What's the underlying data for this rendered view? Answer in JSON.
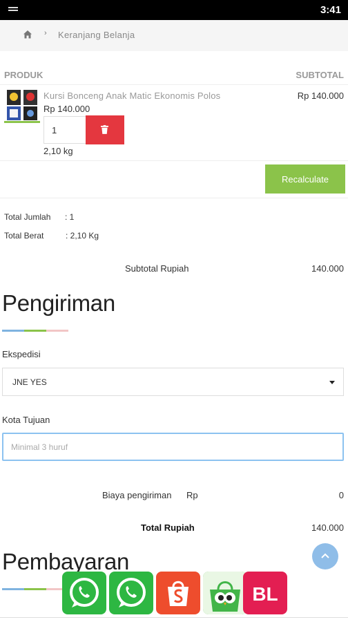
{
  "status_bar": {
    "time": "3:41"
  },
  "breadcrumb": {
    "home_icon": "home-icon",
    "separator": "›",
    "current": "Keranjang Belanja"
  },
  "cart": {
    "headers": {
      "product": "PRODUK",
      "subtotal": "SUBTOTAL"
    },
    "items": [
      {
        "name": "Kursi Bonceng Anak Matic Ekonomis Polos",
        "price": "Rp 140.000",
        "quantity": "1",
        "weight": "2,10 kg",
        "subtotal": "Rp 140.000"
      }
    ],
    "recalculate_label": "Recalculate"
  },
  "summary": {
    "total_qty_label": "Total Jumlah",
    "total_qty_value": ": 1",
    "total_weight_label": "Total Berat",
    "total_weight_value": ": 2,10 Kg",
    "subtotal_label": "Subtotal Rupiah",
    "subtotal_value": "140.000"
  },
  "shipping": {
    "title": "Pengiriman",
    "courier_label": "Ekspedisi",
    "courier_value": "JNE YES",
    "city_label": "Kota Tujuan",
    "city_placeholder": "Minimal 3 huruf",
    "cost_label": "Biaya pengiriman",
    "cost_currency": "Rp",
    "cost_value": "0",
    "total_label": "Total Rupiah",
    "total_value": "140.000"
  },
  "payment": {
    "title": "Pembayaran"
  },
  "floating_links": [
    {
      "name": "whatsapp-button-1",
      "icon": "whatsapp-icon",
      "color": "#2db742"
    },
    {
      "name": "whatsapp-button-2",
      "icon": "whatsapp-icon",
      "color": "#2db742"
    },
    {
      "name": "shopee-button",
      "icon": "shopee-bag-icon",
      "color": "#ee4d2d"
    },
    {
      "name": "tokopedia-button",
      "icon": "tokopedia-owl-icon",
      "color": "#42b549"
    },
    {
      "name": "bukalapak-button",
      "icon": "bukalapak-icon",
      "label": "BL",
      "color": "#e31e52"
    }
  ],
  "colors": {
    "accent_green": "#8bc34a",
    "delete_red": "#e4373f",
    "focus_blue": "#8cc2f0",
    "underline_blue": "#7fb3e0",
    "underline_green": "#8bc34a",
    "underline_pink": "#f2c6c6"
  }
}
